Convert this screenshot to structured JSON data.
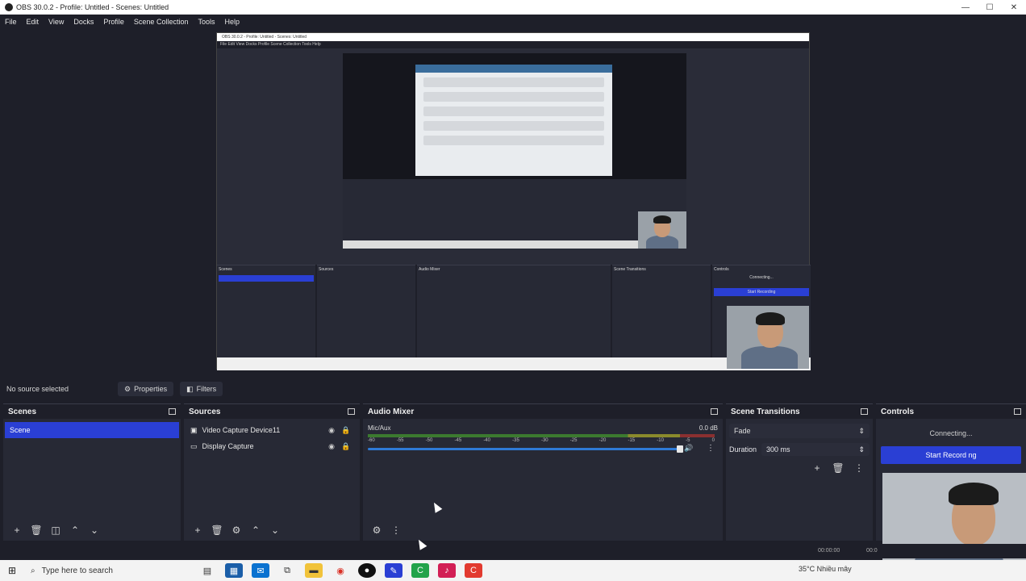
{
  "window": {
    "title": "OBS 30.0.2 - Profile: Untitled - Scenes: Untitled",
    "minimize": "—",
    "maximize": "☐",
    "close": "✕"
  },
  "menu": [
    "File",
    "Edit",
    "View",
    "Docks",
    "Profile",
    "Scene Collection",
    "Tools",
    "Help"
  ],
  "nested": {
    "title": "OBS 30.0.2 - Profile: Untitled - Scenes: Untitled",
    "menu": "File  Edit  View  Docks  Profile  Scene Collection  Tools  Help",
    "scenes": "Scenes",
    "sources": "Sources",
    "mixer": "Audio Mixer",
    "transitions": "Scene Transitions",
    "controls": "Controls",
    "start": "Start Recording",
    "connecting": "Connecting..."
  },
  "source_bar": {
    "no_source": "No source selected",
    "properties": "Properties",
    "filters": "Filters"
  },
  "scenes": {
    "title": "Scenes",
    "items": [
      "Scene"
    ]
  },
  "sources": {
    "title": "Sources",
    "items": [
      "Video Capture Device11",
      "Display Capture"
    ]
  },
  "mixer": {
    "title": "Audio Mixer",
    "channel": "Mic/Aux",
    "db": "0.0 dB",
    "ticks": [
      "-60",
      "-55",
      "-50",
      "-45",
      "-40",
      "-35",
      "-30",
      "-25",
      "-20",
      "-15",
      "-10",
      "-5",
      "0"
    ],
    "volume_fraction": 0.9
  },
  "transitions": {
    "title": "Scene Transitions",
    "type": "Fade",
    "duration_label": "Duration",
    "duration_value": "300 ms"
  },
  "controls": {
    "title": "Controls",
    "status": "Connecting...",
    "start_recording": "Start Record ng"
  },
  "statusbar": {
    "rec": "00:00:00",
    "stream": "00:0"
  },
  "taskbar": {
    "search": "Type here to search",
    "weather": "35°C  Nhiều mây"
  },
  "colors": {
    "bg": "#1e1f29",
    "dock": "#272935",
    "accent": "#2a3fd4"
  }
}
